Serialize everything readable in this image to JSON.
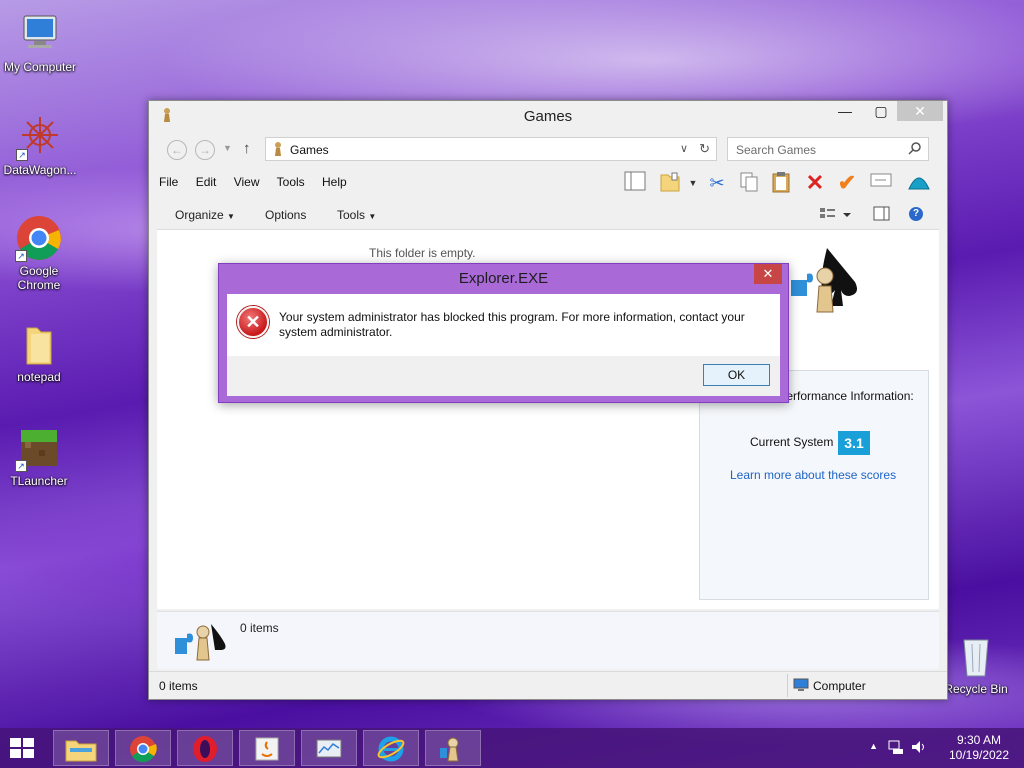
{
  "desktop": {
    "icons": [
      {
        "label": "My Computer"
      },
      {
        "label": "DataWagon..."
      },
      {
        "label": "Google Chrome"
      },
      {
        "label": "notepad"
      },
      {
        "label": "TLauncher"
      },
      {
        "label": "Recycle Bin"
      }
    ]
  },
  "window": {
    "title": "Games",
    "address": "Games",
    "search_placeholder": "Search Games",
    "menu": [
      "File",
      "Edit",
      "View",
      "Tools",
      "Help"
    ],
    "commands": {
      "organize": "Organize",
      "options": "Options",
      "tools": "Tools"
    },
    "empty_message": "This folder is empty.",
    "performance": {
      "heading": "Computer's Performance Information:",
      "system_label": "Current System",
      "score": "3.1",
      "link": "Learn more about these scores"
    },
    "details_count": "0 items",
    "status_left": "0 items",
    "status_right": "Computer"
  },
  "dialog": {
    "title": "Explorer.EXE",
    "message": "Your system administrator has blocked this program. For more information, contact your system administrator.",
    "ok_label": "OK"
  },
  "taskbar": {
    "time": "9:30 AM",
    "date": "10/19/2022"
  },
  "colors": {
    "score_badge": "#1aa0d8",
    "dialog_frame": "#a96ad8",
    "link": "#1e64c8",
    "error_icon": "#c8181a"
  }
}
